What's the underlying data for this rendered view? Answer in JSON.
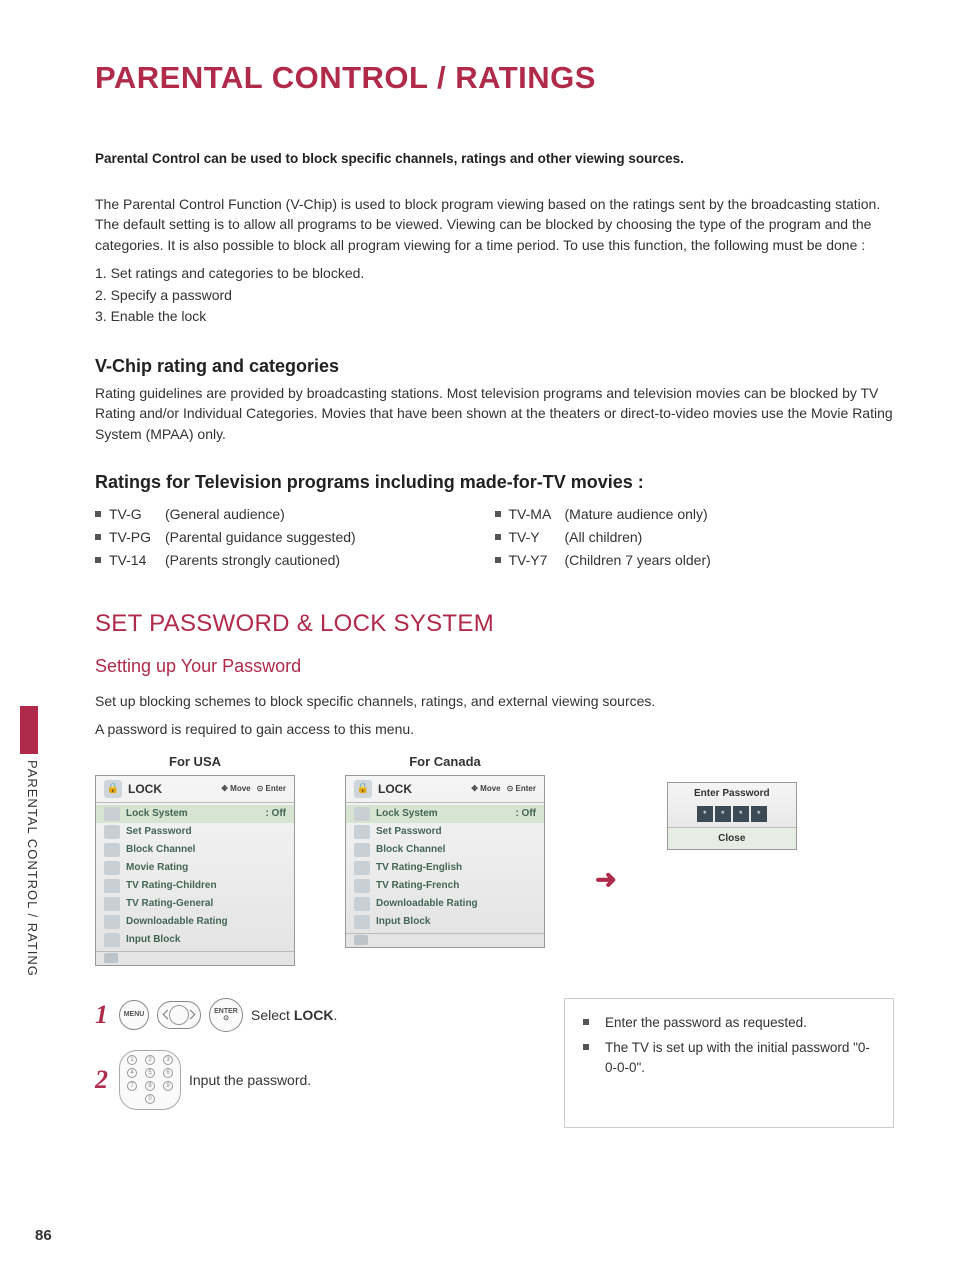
{
  "page_title": "PARENTAL CONTROL / RATINGS",
  "side_tab": "PARENTAL CONTROL / RATING",
  "page_number": "86",
  "intro_bold": "Parental Control can be used to block specific channels, ratings and other viewing sources.",
  "intro_para": "The Parental Control Function (V-Chip) is used to block program viewing based on the ratings sent by the broadcasting station. The default setting is to allow all programs to be viewed. Viewing can be blocked by choosing the type of the program and the categories. It is also possible to block all program viewing for a time period. To use this function, the following must be done :",
  "steps": [
    "1. Set ratings and categories to be blocked.",
    "2. Specify a password",
    "3. Enable the lock"
  ],
  "vchip_h": "V-Chip rating and categories",
  "vchip_p": "Rating guidelines are provided by broadcasting stations. Most television programs and television movies can be blocked by TV Rating and/or Individual Categories. Movies that have been shown at the theaters or direct-to-video movies use the Movie Rating System (MPAA) only.",
  "ratings_h": "Ratings for Television programs including made-for-TV movies :",
  "ratings_left": [
    {
      "code": "TV-G",
      "desc": "(General audience)"
    },
    {
      "code": "TV-PG",
      "desc": "(Parental guidance suggested)"
    },
    {
      "code": "TV-14",
      "desc": "(Parents strongly cautioned)"
    }
  ],
  "ratings_right": [
    {
      "code": "TV-MA",
      "desc": "(Mature audience only)"
    },
    {
      "code": "TV-Y",
      "desc": "(All children)"
    },
    {
      "code": "TV-Y7",
      "desc": "(Children 7 years older)"
    }
  ],
  "set_pw_title": "SET PASSWORD & LOCK SYSTEM",
  "set_pw_sub": "Setting up Your Password",
  "set_pw_p1": "Set up blocking schemes to block specific channels, ratings, and external viewing sources.",
  "set_pw_p2": "A password is required to gain access to this menu.",
  "panel_usa": {
    "caption": "For USA",
    "title": "LOCK",
    "nav_move": "Move",
    "nav_enter": "Enter",
    "items": [
      {
        "label": "Lock System",
        "val": ": Off"
      },
      {
        "label": "Set Password",
        "val": ""
      },
      {
        "label": "Block Channel",
        "val": ""
      },
      {
        "label": "Movie Rating",
        "val": ""
      },
      {
        "label": "TV Rating-Children",
        "val": ""
      },
      {
        "label": "TV Rating-General",
        "val": ""
      },
      {
        "label": "Downloadable Rating",
        "val": ""
      },
      {
        "label": "Input Block",
        "val": ""
      }
    ]
  },
  "panel_can": {
    "caption": "For Canada",
    "title": "LOCK",
    "nav_move": "Move",
    "nav_enter": "Enter",
    "items": [
      {
        "label": "Lock System",
        "val": ": Off"
      },
      {
        "label": "Set Password",
        "val": ""
      },
      {
        "label": "Block Channel",
        "val": ""
      },
      {
        "label": "TV Rating-English",
        "val": ""
      },
      {
        "label": "TV Rating-French",
        "val": ""
      },
      {
        "label": "Downloadable Rating",
        "val": ""
      },
      {
        "label": "Input Block",
        "val": ""
      }
    ]
  },
  "pw_box": {
    "title": "Enter Password",
    "close": "Close"
  },
  "step1": {
    "menu": "MENU",
    "enter": "ENTER",
    "text_a": "Select ",
    "lock": "LOCK",
    "text_b": "."
  },
  "step2": {
    "text": "Input the password."
  },
  "notes": [
    "Enter the password as requested.",
    "The TV is set up with the initial password \"0-0-0-0\"."
  ]
}
